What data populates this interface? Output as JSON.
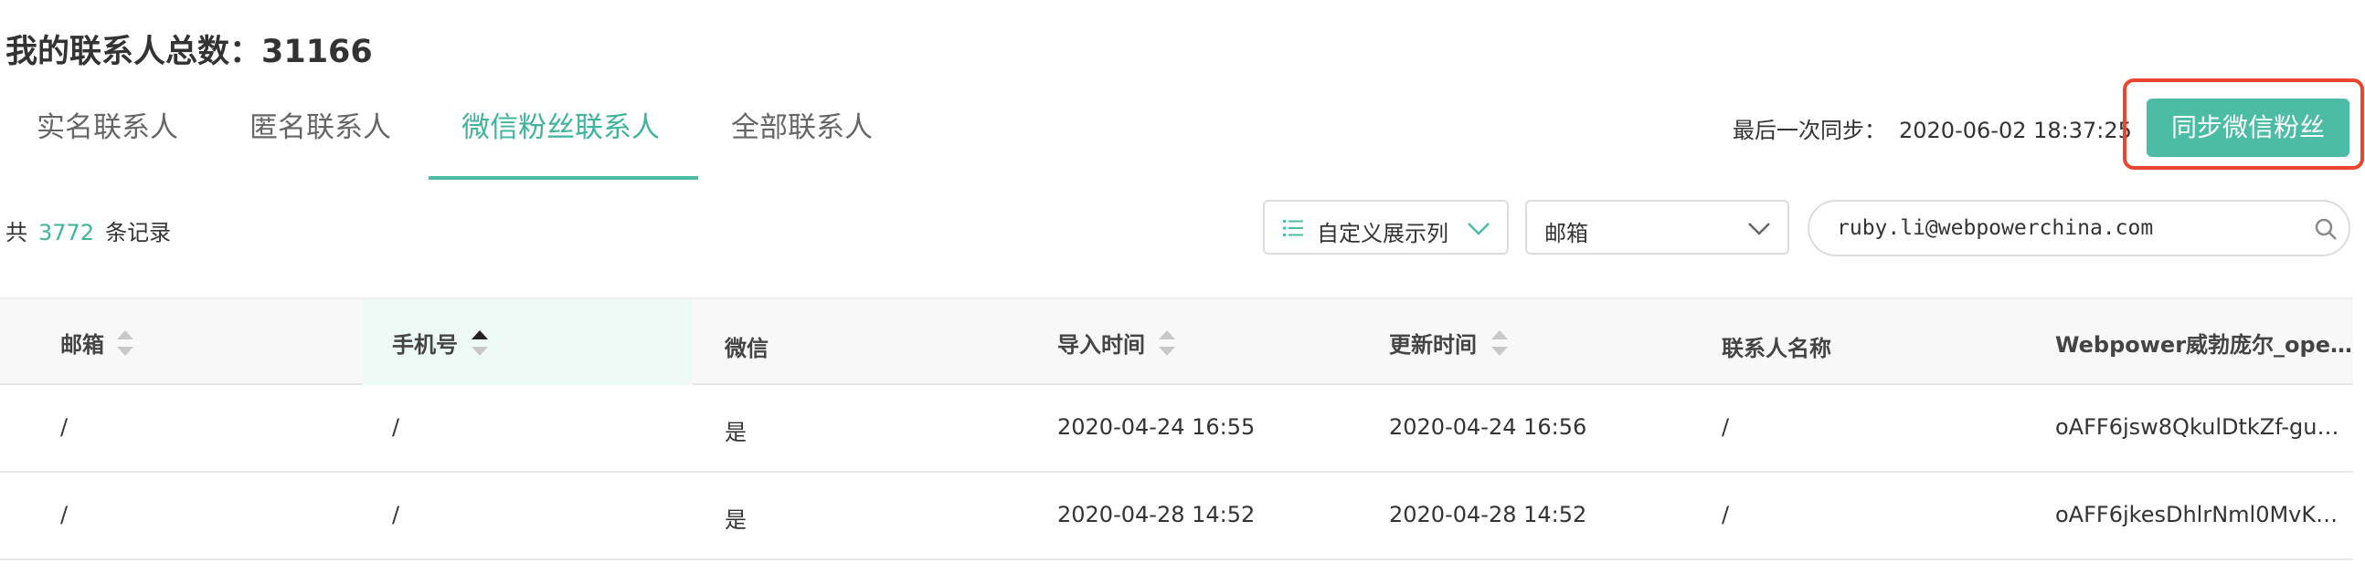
{
  "header": {
    "title": "我的联系人总数：31166"
  },
  "tabs": [
    {
      "label": "实名联系人",
      "active": false
    },
    {
      "label": "匿名联系人",
      "active": false
    },
    {
      "label": "微信粉丝联系人",
      "active": true
    },
    {
      "label": "全部联系人",
      "active": false
    }
  ],
  "sync": {
    "last_label": "最后一次同步：",
    "last_time": "2020-06-02 18:37:25",
    "button_label": "同步微信粉丝"
  },
  "toolbar": {
    "count_prefix": "共",
    "count_value": "3772",
    "count_suffix": "条记录",
    "columns_select_label": "自定义展示列",
    "field_select_value": "邮箱",
    "search_value": "ruby.li@webpowerchina.com"
  },
  "table": {
    "columns": [
      {
        "label": "邮箱",
        "sortable": true,
        "sort": "none"
      },
      {
        "label": "手机号",
        "sortable": true,
        "sort": "asc"
      },
      {
        "label": "微信",
        "sortable": false
      },
      {
        "label": "导入时间",
        "sortable": true,
        "sort": "none"
      },
      {
        "label": "更新时间",
        "sortable": true,
        "sort": "none"
      },
      {
        "label": "联系人名称",
        "sortable": false
      },
      {
        "label": "Webpower威勃庞尔_ope…",
        "sortable": false
      }
    ],
    "rows": [
      [
        "/",
        "/",
        "是",
        "2020-04-24 16:55",
        "2020-04-24 16:56",
        "/",
        "oAFF6jsw8QkulDtkZf-gu…"
      ],
      [
        "/",
        "/",
        "是",
        "2020-04-28 14:52",
        "2020-04-28 14:52",
        "/",
        "oAFF6jkesDhlrNml0MvK…"
      ]
    ]
  },
  "colors": {
    "accent": "#4cbca5",
    "accent_text": "#3fb39b",
    "highlight_border": "#e8462f",
    "sorted_column_bg": "#eefaf6"
  }
}
